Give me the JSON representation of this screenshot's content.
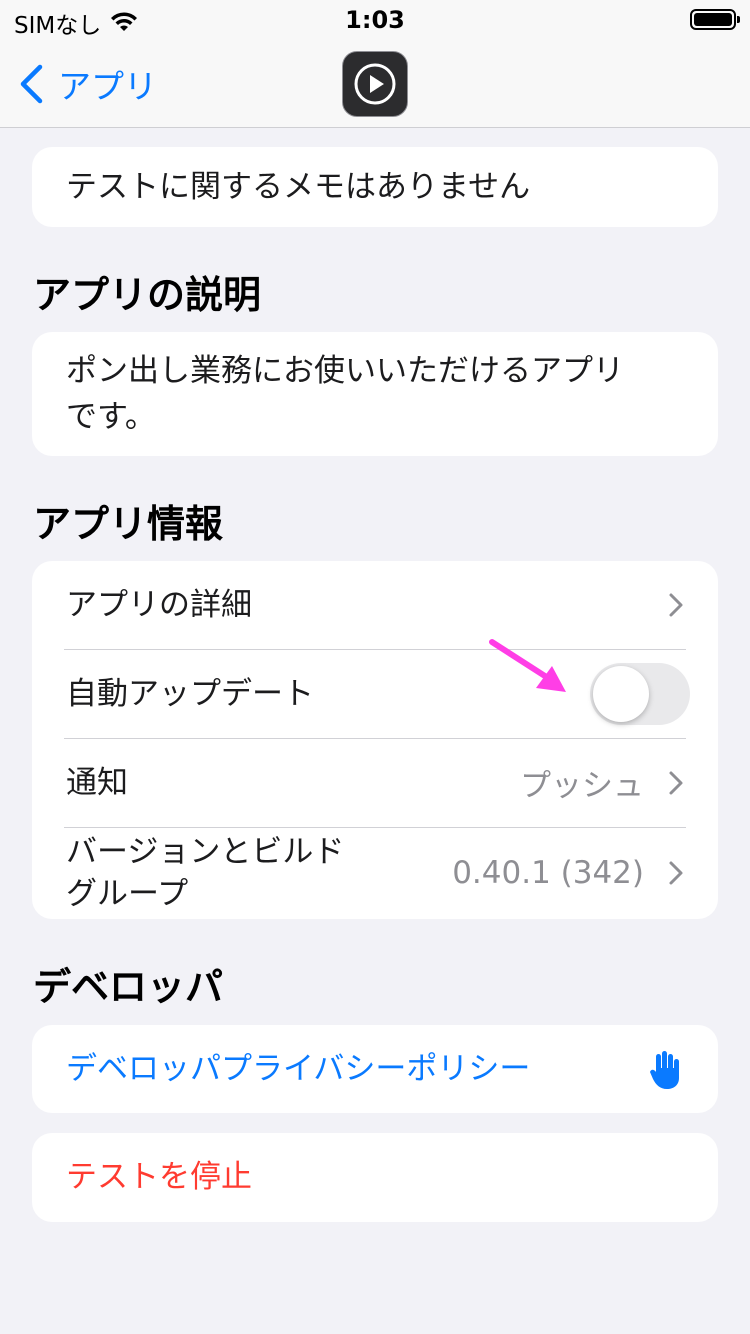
{
  "status_bar": {
    "carrier": "SIMなし",
    "time": "1:03"
  },
  "nav": {
    "back_label": "アプリ",
    "app_icon": "play-icon"
  },
  "notes": {
    "text": "テストに関するメモはありません"
  },
  "description": {
    "title": "アプリの説明",
    "line1": "ポン出し業務にお使いいただけるアプリ",
    "line2": "です。"
  },
  "app_info": {
    "title": "アプリ情報",
    "details_label": "アプリの詳細",
    "auto_update_label": "自動アップデート",
    "auto_update_on": false,
    "notifications_label": "通知",
    "notifications_value": "プッシュ",
    "version_label_line1": "バージョンとビルド",
    "version_label_line2": "グループ",
    "version_value": "0.40.1 (342)"
  },
  "developer": {
    "title": "デベロッパ",
    "privacy_label": "デベロッパプライバシーポリシー",
    "privacy_icon": "hand-raised-icon"
  },
  "stop_test": {
    "label": "テストを停止"
  },
  "colors": {
    "accent": "#0a7aff",
    "destructive": "#ff3b30",
    "annotation_arrow": "#ff3ee6"
  }
}
